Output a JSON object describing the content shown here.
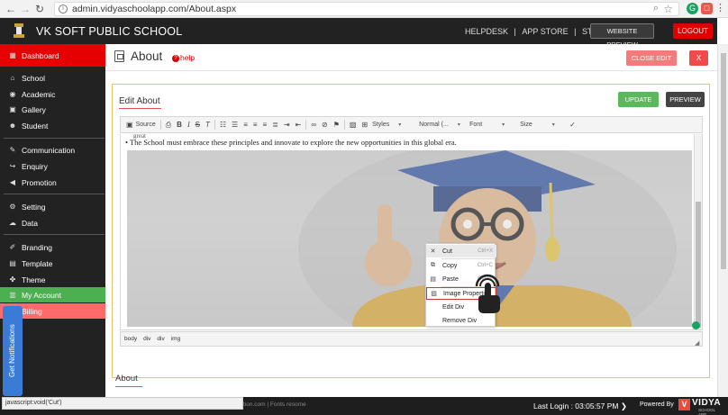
{
  "browser": {
    "url": "admin.vidyaschoolapp.com/About.aspx",
    "ext_grammarly": "G",
    "ext_red": "□",
    "menu_dots": "⋮"
  },
  "header": {
    "school_name": "VK SOFT PUBLIC SCHOOL",
    "links": [
      "HELPDESK",
      "|",
      "APP STORE",
      "|",
      "STORE"
    ],
    "website_preview_label": "WEBSITE PREVIEW",
    "logout_label": "LOGOUT"
  },
  "sidebar": {
    "items": [
      {
        "label": "Dashboard",
        "icon": "dashboard-icon"
      },
      {
        "label": "School",
        "icon": "school-icon"
      },
      {
        "label": "Academic",
        "icon": "academic-icon"
      },
      {
        "label": "Gallery",
        "icon": "gallery-icon"
      },
      {
        "label": "Student",
        "icon": "student-icon"
      },
      {
        "label": "Communication",
        "icon": "communication-icon"
      },
      {
        "label": "Enquiry",
        "icon": "enquiry-icon"
      },
      {
        "label": "Promotion",
        "icon": "promotion-icon"
      },
      {
        "label": "Setting",
        "icon": "setting-icon"
      },
      {
        "label": "Data",
        "icon": "data-icon"
      },
      {
        "label": "Branding",
        "icon": "branding-icon"
      },
      {
        "label": "Template",
        "icon": "template-icon"
      },
      {
        "label": "Theme",
        "icon": "theme-icon"
      },
      {
        "label": "My Account",
        "icon": "account-icon"
      },
      {
        "label": "Billing",
        "icon": "billing-icon"
      }
    ],
    "notifications_label": "Get Notifications"
  },
  "page": {
    "title": "About",
    "help_label": "help",
    "close_edit_label": "CLOSE EDIT",
    "close_label": "X"
  },
  "editor": {
    "panel_title": "Edit About",
    "update_label": "UPDATE",
    "preview_label": "PREVIEW",
    "toolbar": {
      "source_label": "Source",
      "styles_label": "Styles",
      "format_label": "Normal (...",
      "font_label": "Font",
      "size_label": "Size"
    },
    "cut_text": "great",
    "bullet_text": "The School must embrace these principles and innovate to explore the new opportunities in this global era.",
    "elements_path": [
      "body",
      "div",
      "div",
      "img"
    ]
  },
  "context_menu": {
    "items": [
      {
        "label": "Cut",
        "shortcut": "Ctrl+X",
        "icon": "cut-icon"
      },
      {
        "label": "Copy",
        "shortcut": "Ctrl+C",
        "icon": "copy-icon"
      },
      {
        "label": "Paste",
        "shortcut": "Ctrl+V",
        "icon": "paste-icon"
      },
      {
        "label": "Image Properties",
        "shortcut": "",
        "icon": "image-icon"
      },
      {
        "label": "Edit Div",
        "shortcut": "",
        "icon": ""
      },
      {
        "label": "Remove Div",
        "shortcut": "",
        "icon": ""
      }
    ]
  },
  "about_section": {
    "title": "About"
  },
  "footer": {
    "small_text": "tion.com | Fonts resome",
    "last_login": "Last Login : 03:05:57 PM",
    "powered_by": "Powered By",
    "brand": "VIDYA",
    "brand_sub": "SCHOOL APP"
  },
  "status_bar": {
    "text": "javascript:void('Cut')"
  },
  "colors": {
    "header_bg": "#222222",
    "dashboard_active": "#e60000",
    "my_account": "#4caf50",
    "billing": "#ff6b6b",
    "logout": "#e10000",
    "update": "#5cb85c"
  }
}
